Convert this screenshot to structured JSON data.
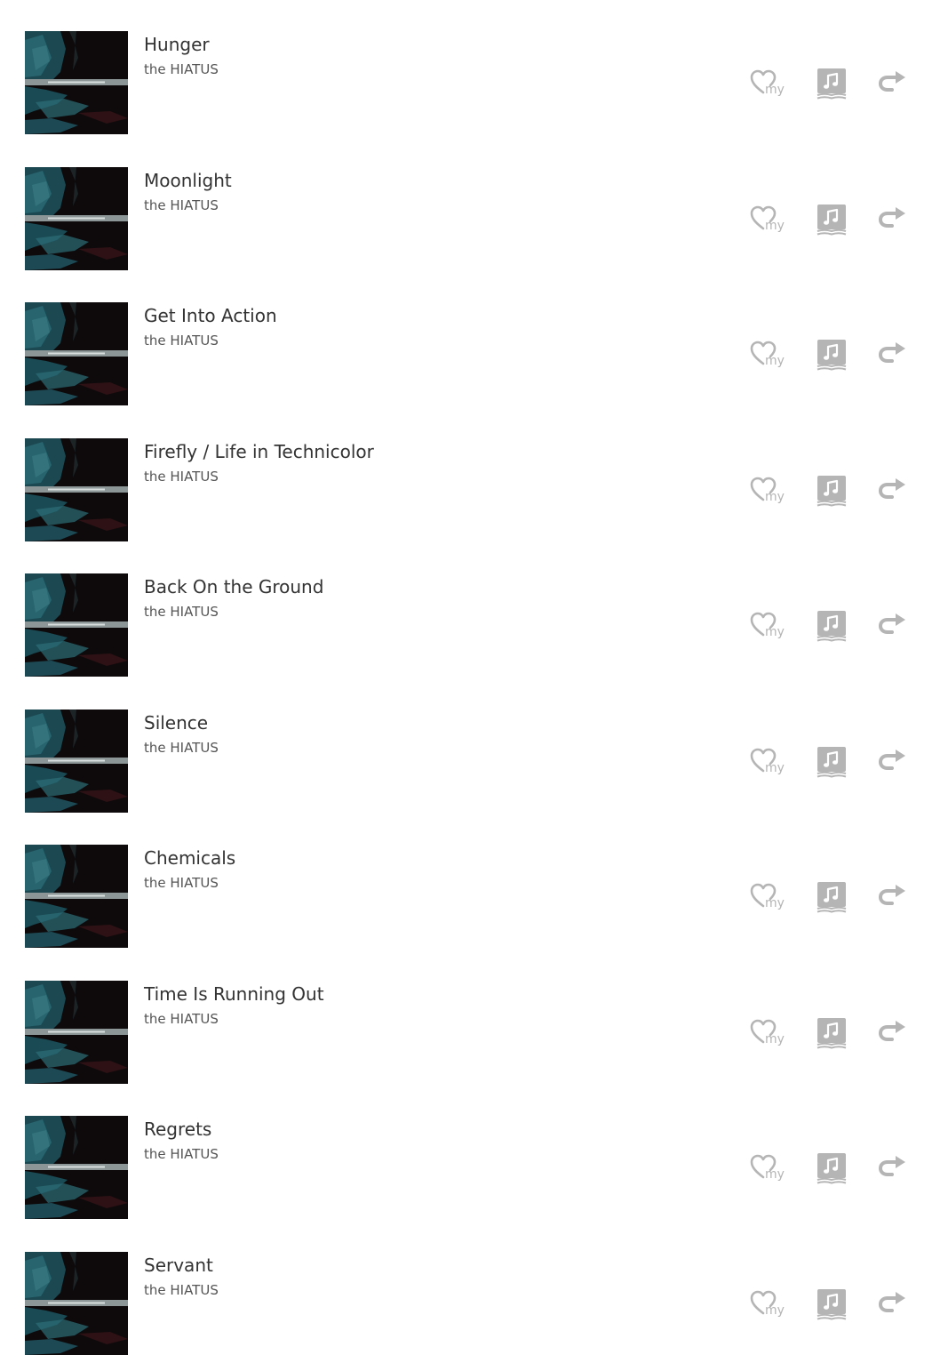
{
  "tracks": [
    {
      "title": "Hunger",
      "artist": "the HIATUS"
    },
    {
      "title": "Moonlight",
      "artist": "the HIATUS"
    },
    {
      "title": "Get Into Action",
      "artist": "the HIATUS"
    },
    {
      "title": "Firefly / Life in Technicolor",
      "artist": "the HIATUS"
    },
    {
      "title": "Back On the Ground",
      "artist": "the HIATUS"
    },
    {
      "title": "Silence",
      "artist": "the HIATUS"
    },
    {
      "title": "Chemicals",
      "artist": "the HIATUS"
    },
    {
      "title": "Time Is Running Out",
      "artist": "the HIATUS"
    },
    {
      "title": "Regrets",
      "artist": "the HIATUS"
    },
    {
      "title": "Servant",
      "artist": "the HIATUS"
    }
  ],
  "actions": {
    "my_label": "my",
    "my_icon": "heart-my-icon",
    "lyrics_icon": "music-note-book-icon",
    "share_icon": "share-arrow-icon"
  },
  "colors": {
    "icon_gray": "#b5b5b5",
    "title_text": "#333333",
    "artist_text": "#555555",
    "cover_dark": "#0e0a0b",
    "cover_teal": "#1f5a66"
  }
}
